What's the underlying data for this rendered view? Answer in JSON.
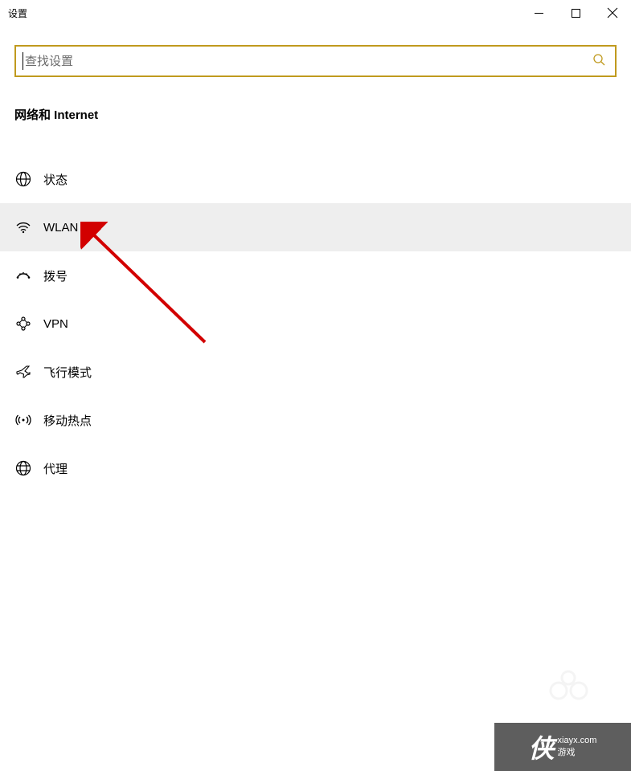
{
  "window": {
    "title": "设置"
  },
  "search": {
    "placeholder": "查找设置"
  },
  "section": {
    "title": "网络和 Internet"
  },
  "nav": {
    "items": [
      {
        "icon": "globe",
        "label": "状态",
        "selected": false
      },
      {
        "icon": "wifi",
        "label": "WLAN",
        "selected": true
      },
      {
        "icon": "dial",
        "label": "拨号",
        "selected": false
      },
      {
        "icon": "vpn",
        "label": "VPN",
        "selected": false
      },
      {
        "icon": "airplane",
        "label": "飞行模式",
        "selected": false
      },
      {
        "icon": "hotspot",
        "label": "移动热点",
        "selected": false
      },
      {
        "icon": "proxy",
        "label": "代理",
        "selected": false
      }
    ]
  },
  "watermark": {
    "chars": "侠",
    "url": "xiayx.com",
    "label": "游戏"
  }
}
